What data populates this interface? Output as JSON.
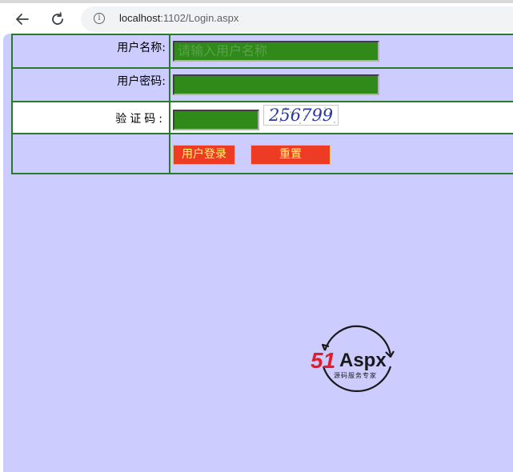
{
  "browser": {
    "url_host": "localhost",
    "url_rest": ":1102/Login.aspx",
    "info_icon": "info-icon",
    "back_icon": "arrow-left-icon",
    "reload_icon": "reload-icon"
  },
  "form": {
    "username_label": "用户名称:",
    "username_placeholder": "请输入用户名称",
    "password_label": "用户密码:",
    "captcha_label": "验证码:",
    "captcha_code": "256799",
    "login_button": "用户登录",
    "reset_button": "重置"
  },
  "logo": {
    "brand_51": "51",
    "brand_aspx": "Aspx",
    "tagline": "源码服务专家"
  },
  "colors": {
    "page_bg": "#ccccff",
    "table_border": "#2b7a2b",
    "input_bg": "#2f8a1a",
    "button_bg": "#ee3b24",
    "button_text": "#ffff66"
  }
}
